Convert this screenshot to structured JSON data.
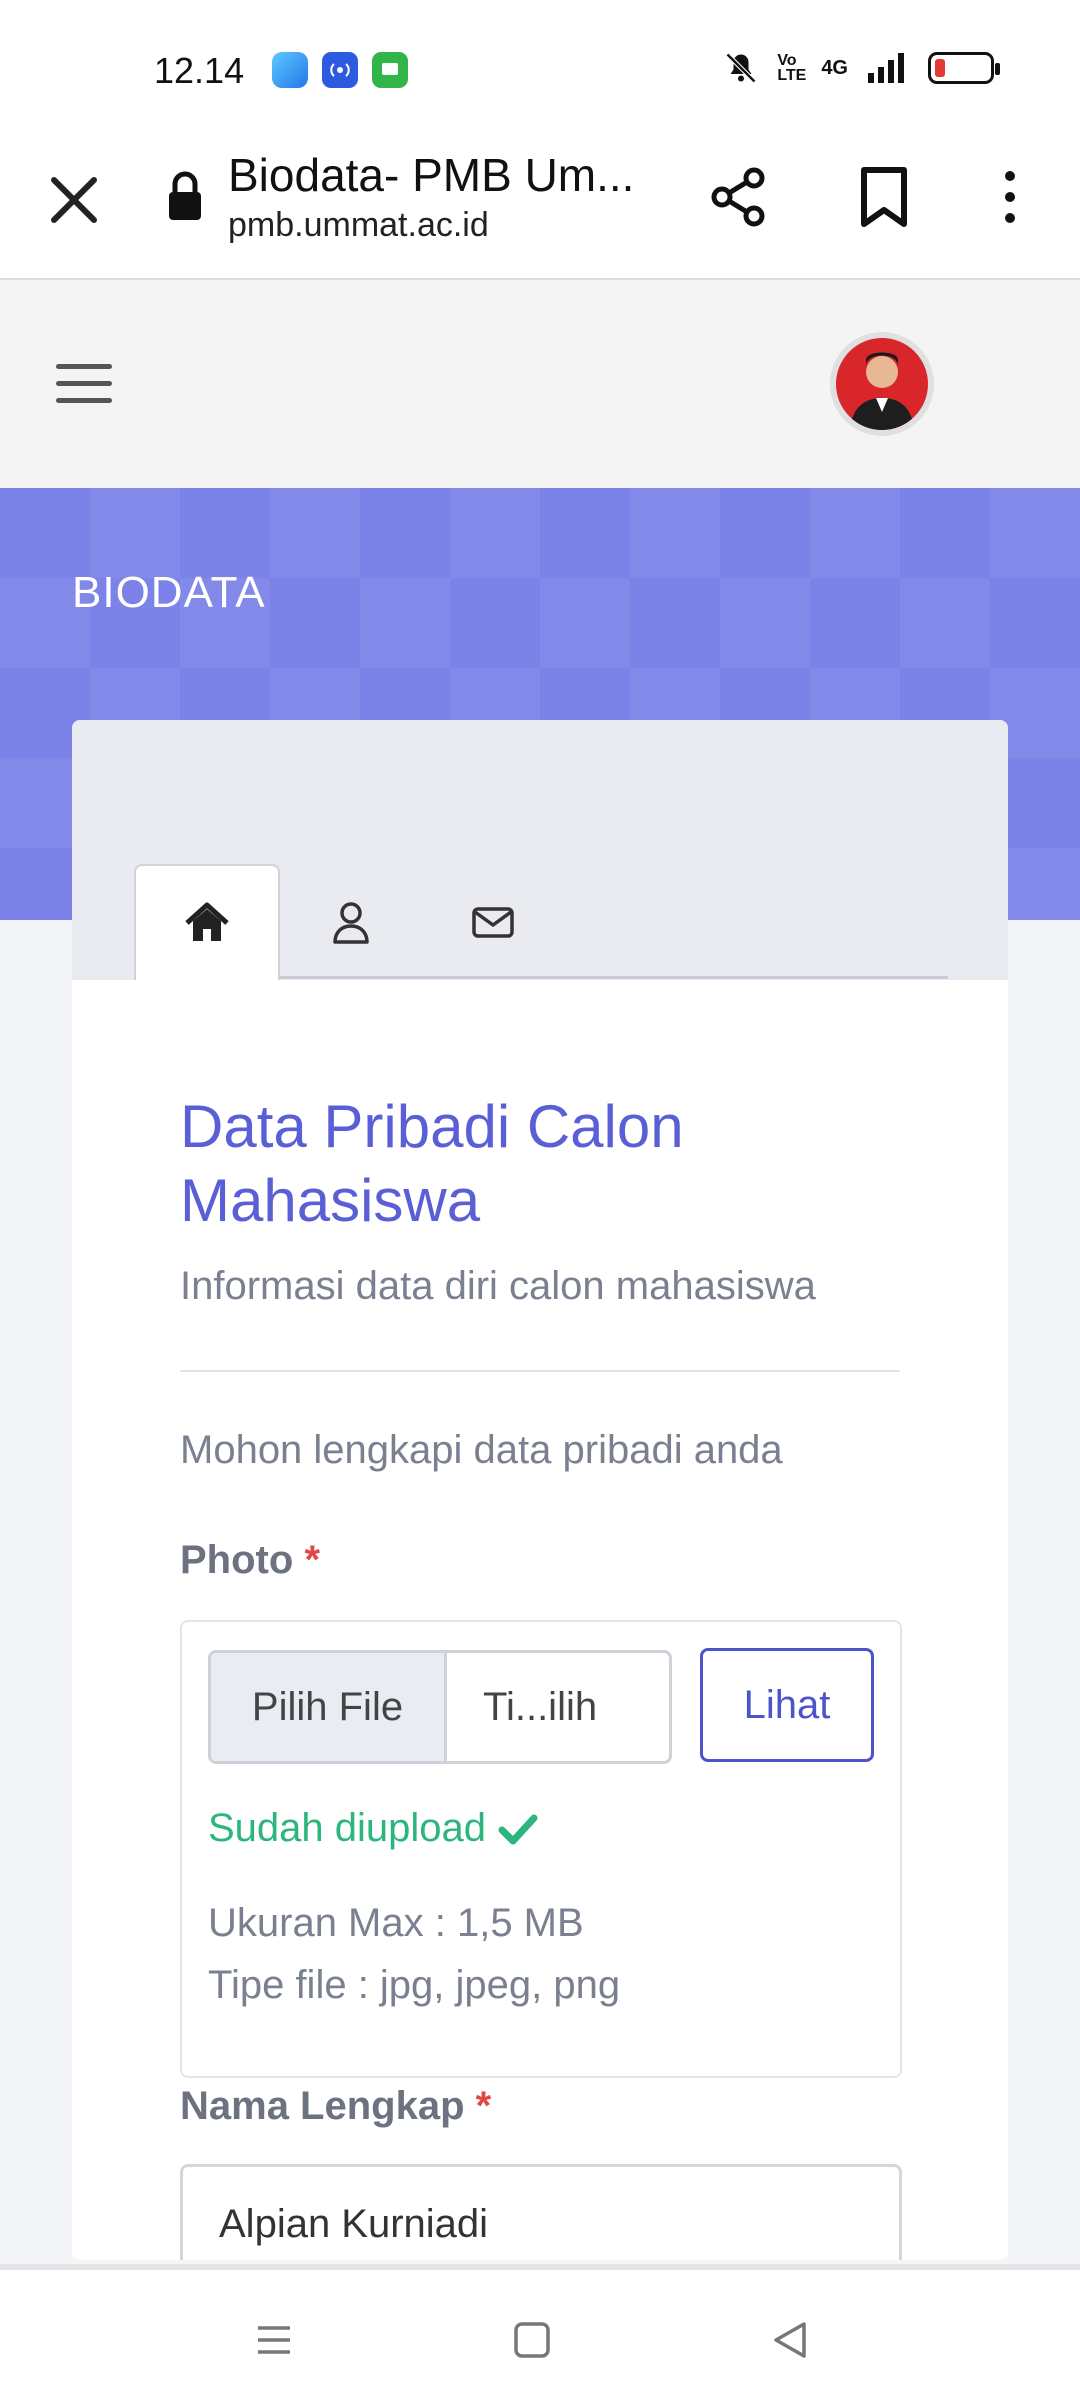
{
  "status_bar": {
    "time": "12.14",
    "network": "4G",
    "volte": "Vo LTE"
  },
  "browser": {
    "page_title": "Biodata- PMB Um...",
    "url": "pmb.ummat.ac.id"
  },
  "banner": {
    "title": "BIODATA"
  },
  "tabs": [
    {
      "icon": "home-icon",
      "active": true
    },
    {
      "icon": "user-icon",
      "active": false
    },
    {
      "icon": "envelope-icon",
      "active": false
    }
  ],
  "form": {
    "title": "Data Pribadi Calon Mahasiswa",
    "subtitle": "Informasi data diri calon mahasiswa",
    "intro": "Mohon lengkapi data pribadi anda",
    "photo": {
      "label": "Photo",
      "required_mark": "*",
      "choose_label": "Pilih File",
      "file_name": "Ti...ilih",
      "view_label": "Lihat",
      "status": "Sudah diupload",
      "max_size": "Ukuran Max : 1,5 MB",
      "file_types": "Tipe file : jpg, jpeg, png"
    },
    "full_name": {
      "label": "Nama Lengkap",
      "required_mark": "*",
      "value": "Alpian Kurniadi"
    }
  },
  "colors": {
    "accent": "#5b5fd6",
    "banner": "#7b83e8",
    "success": "#2cb67d",
    "required": "#e04848"
  }
}
